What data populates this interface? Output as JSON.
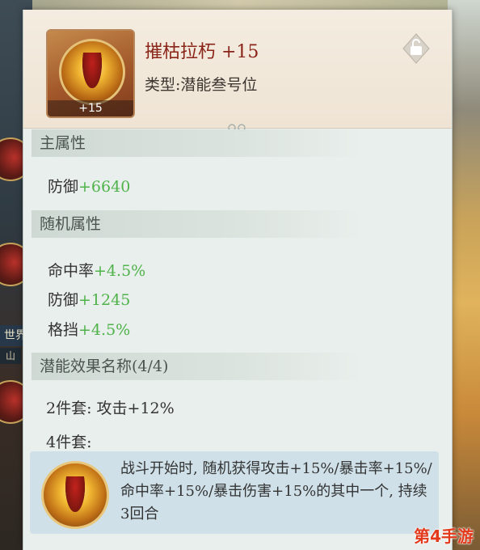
{
  "background": {
    "left_tag": "世界",
    "left_tag2": "山"
  },
  "item": {
    "name": "摧枯拉朽 +15",
    "type": "类型:潜能叁号位",
    "level_badge": "+15",
    "icon": "flame-warrior-orb-icon",
    "lock_icon": "unlocked-padlock-icon"
  },
  "main_attr": {
    "title": "主属性",
    "stats": [
      {
        "label": "防御",
        "value": "+6640"
      }
    ]
  },
  "random_attr": {
    "title": "随机属性",
    "stats": [
      {
        "label": "命中率",
        "value": "+4.5%"
      },
      {
        "label": "防御",
        "value": "+1245"
      },
      {
        "label": "格挡",
        "value": "+4.5%"
      }
    ]
  },
  "potential": {
    "title": "潜能效果名称(4/4)",
    "set2": "2件套: 攻击+12%",
    "set4": "4件套:",
    "set4_desc": "战斗开始时, 随机获得攻击+15%/暴击率+15%/命中率+15%/暴击伤害+15%的其中一个, 持续3回合"
  },
  "watermark": "第4手游",
  "colors": {
    "name": "#8a2418",
    "stat_value": "#4fb24a",
    "watermark": "#e23a1b"
  }
}
